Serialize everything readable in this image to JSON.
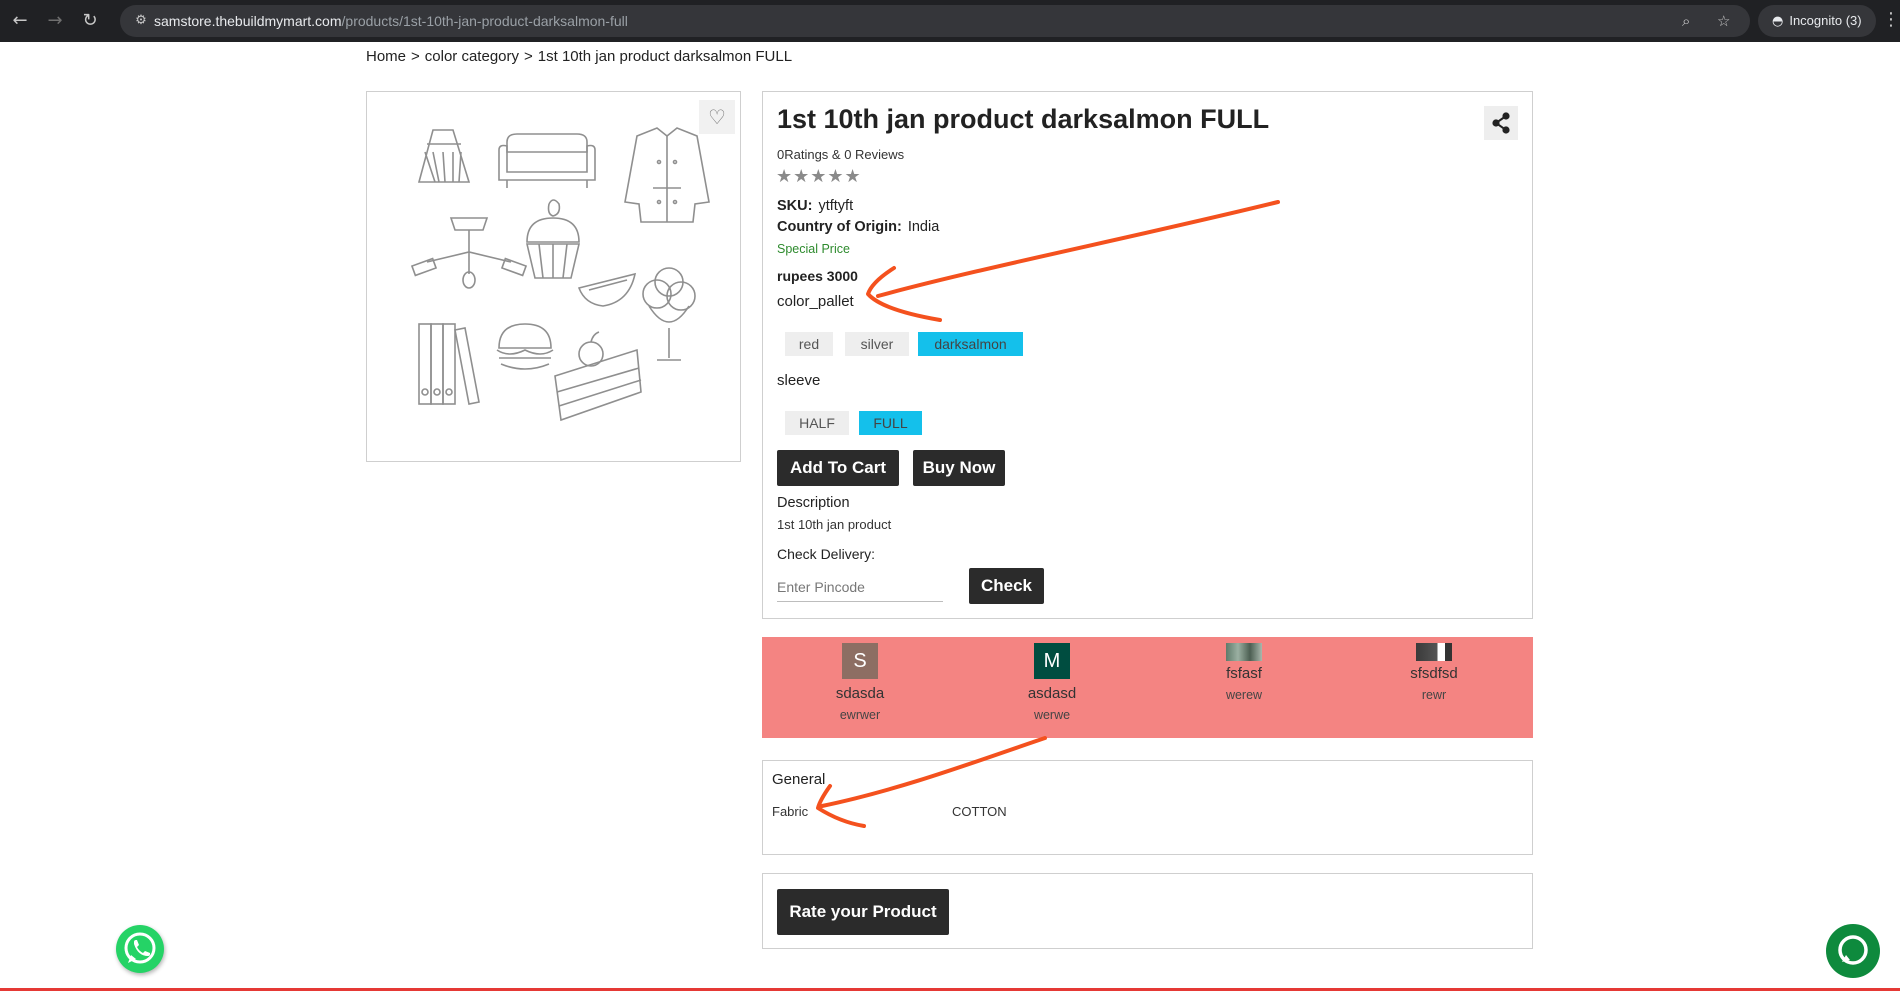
{
  "browser": {
    "url_host": "samstore.thebuildmymart.com",
    "url_path": "/products/1st-10th-jan-product-darksalmon-full",
    "incognito_label": "Incognito (3)"
  },
  "breadcrumb": [
    "Home",
    ">",
    "color category",
    ">",
    "1st 10th jan product darksalmon FULL"
  ],
  "product": {
    "title": "1st 10th jan product darksalmon FULL",
    "ratings_text": "0Ratings & 0 Reviews",
    "stars": "★★★★★",
    "sku_label": "SKU:",
    "sku_value": "ytftyft",
    "origin_label": "Country of Origin:",
    "origin_value": "India",
    "special_price_label": "Special Price",
    "price": "rupees 3000",
    "color_option_label": "color_pallet",
    "color_options": [
      "red",
      "silver",
      "darksalmon"
    ],
    "selected_color": "darksalmon",
    "sleeve_option_label": "sleeve",
    "sleeve_options": [
      "HALF",
      "FULL"
    ],
    "selected_sleeve": "FULL",
    "add_to_cart": "Add To Cart",
    "buy_now": "Buy Now",
    "description_label": "Description",
    "description": "1st 10th jan product",
    "delivery_label": "Check Delivery:",
    "pincode_placeholder": "Enter Pincode",
    "check_button": "Check"
  },
  "testimonials": {
    "background": "#f48482",
    "items": [
      {
        "avatar_letter": "S",
        "avatar_color": "#8d6e63",
        "name": "sdasda",
        "text": "ewrwer"
      },
      {
        "avatar_letter": "M",
        "avatar_color": "#004d40",
        "name": "asdasd",
        "text": "werwe"
      },
      {
        "avatar_letter": "",
        "name": "fsfasf",
        "text": "werew"
      },
      {
        "avatar_letter": "",
        "name": "sfsdfsd",
        "text": "rewr"
      }
    ]
  },
  "specs": {
    "heading": "General",
    "rows": [
      {
        "key": "Fabric",
        "value": "COTTON"
      }
    ]
  },
  "rate_button": "Rate your Product",
  "icons": {
    "wishlist": "heart-icon",
    "share": "share-icon",
    "whatsapp": "whatsapp-icon",
    "chat": "chat-icon"
  },
  "colors": {
    "selected_chip": "#14c0eb",
    "dark_button": "#2b2b2b",
    "annotation_arrow": "#f4511e",
    "special_price": "#2e8b2e"
  }
}
